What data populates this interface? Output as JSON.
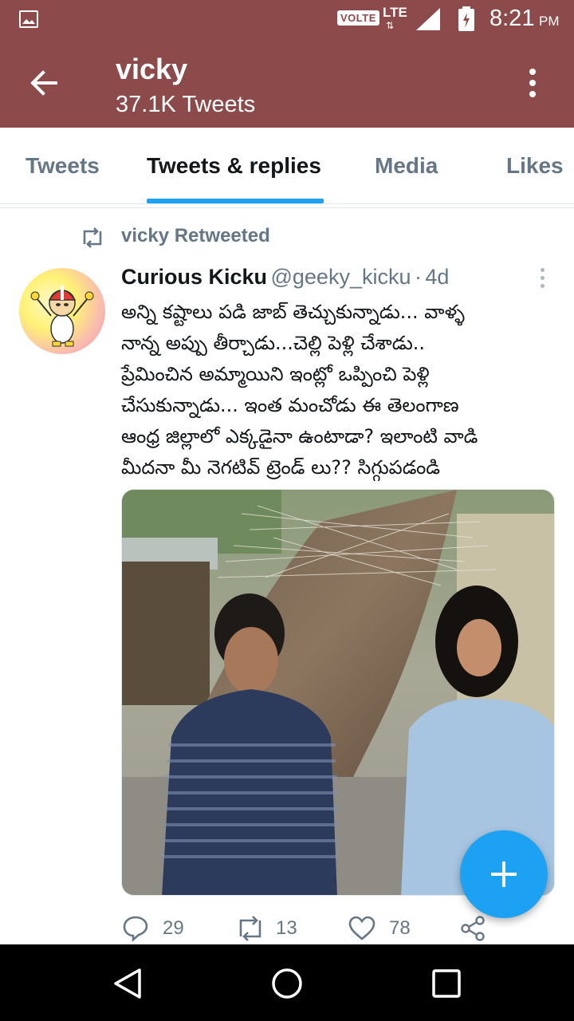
{
  "status_bar": {
    "volte": "VOLTE",
    "network": "LTE",
    "network_arrows": "⇅",
    "time": "8:21",
    "ampm": "PM",
    "icons": [
      "gallery-icon",
      "signal-icon",
      "battery-charging-icon"
    ]
  },
  "header": {
    "name": "vicky",
    "tweet_count": "37.1K Tweets",
    "back_icon": "arrow-left-icon",
    "more_icon": "more-vertical-icon"
  },
  "tabs": [
    {
      "label": "Tweets",
      "active": false
    },
    {
      "label": "Tweets & replies",
      "active": true
    },
    {
      "label": "Media",
      "active": false
    },
    {
      "label": "Likes",
      "active": false
    }
  ],
  "tweet": {
    "retweet_label": "vicky Retweeted",
    "author": "Curious Kicku",
    "handle": "@geeky_kicku",
    "separator": "·",
    "age": "4d",
    "text_lines": [
      "అన్ని కష్టాలు పడి జాబ్ తెచ్చుకున్నాడు... వాళ్ళ",
      "నాన్న అప్పు తీర్చాడు...చెల్లి పెళ్లి చేశాడు..",
      "ప్రేమించిన అమ్మాయిని ఇంట్లో ఒప్పించి పెళ్లి",
      "చేసుకున్నాడు... ఇంత మంచోడు ఈ తెలంగాణ",
      "ఆంధ్ర జిల్లాలో ఎక్కడైనా ఉంటాడా? ఇలాంటి వాడి",
      "మీదనా మీ నెగటివ్ ట్రెండ్ లు?? సిగ్గుపడండి"
    ],
    "replies": "29",
    "retweets": "13",
    "likes": "78"
  },
  "colors": {
    "header_bg": "#8d4a4a",
    "accent": "#1da1f2",
    "secondary_text": "#657786"
  },
  "navbar": {
    "icons": [
      "back-triangle-icon",
      "home-circle-icon",
      "recents-square-icon"
    ]
  }
}
